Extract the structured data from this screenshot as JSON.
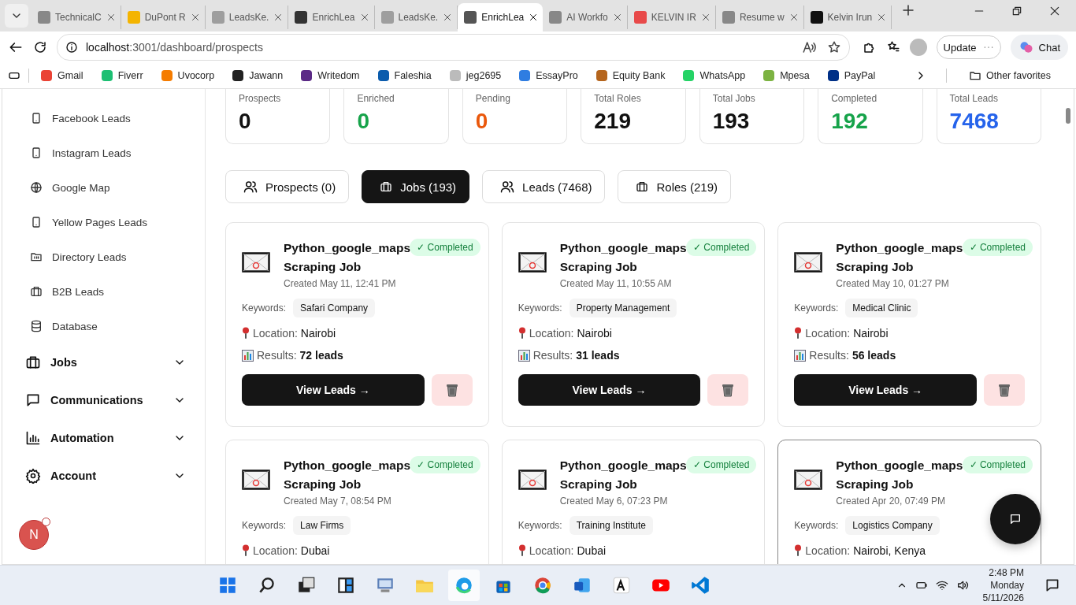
{
  "browser": {
    "tabs": [
      {
        "title": "TechnicalC",
        "selected": false
      },
      {
        "title": "DuPont R",
        "selected": false
      },
      {
        "title": "LeadsKe.",
        "selected": false
      },
      {
        "title": "EnrichLea",
        "selected": false
      },
      {
        "title": "LeadsKe.",
        "selected": false
      },
      {
        "title": "EnrichLea",
        "selected": true
      },
      {
        "title": "AI Workfo",
        "selected": false
      },
      {
        "title": "KELVIN IR",
        "selected": false
      },
      {
        "title": "Resume w",
        "selected": false
      },
      {
        "title": "Kelvin Irun",
        "selected": false
      }
    ],
    "address": {
      "host": "localhost",
      "path": ":3001/dashboard/prospects"
    },
    "update_button": "Update",
    "chat_button": "Chat",
    "bookmarks": [
      "Gmail",
      "Fiverr",
      "Uvocorp",
      "Jawann",
      "Writedom",
      "Faleshia",
      "jeg2695",
      "EssayPro",
      "Equity Bank",
      "WhatsApp",
      "Mpesa",
      "PayPal"
    ],
    "other_favorites": "Other favorites"
  },
  "sidebar": {
    "items": [
      {
        "kind": "link",
        "label": "Facebook Leads"
      },
      {
        "kind": "link",
        "label": "Instagram Leads"
      },
      {
        "kind": "link",
        "label": "Google Map"
      },
      {
        "kind": "link",
        "label": "Yellow Pages Leads"
      },
      {
        "kind": "link",
        "label": "Directory Leads"
      },
      {
        "kind": "link",
        "label": "B2B Leads"
      },
      {
        "kind": "link",
        "label": "Database"
      },
      {
        "kind": "group",
        "label": "Jobs",
        "expanded": false
      },
      {
        "kind": "group",
        "label": "Communications",
        "expanded": false
      },
      {
        "kind": "group",
        "label": "Automation",
        "expanded": false
      },
      {
        "kind": "group",
        "label": "Account",
        "expanded": false
      }
    ],
    "avatar": "N"
  },
  "stats": [
    {
      "label": "Prospects",
      "value": "0",
      "color": "#111111"
    },
    {
      "label": "Enriched",
      "value": "0",
      "color": "#16a34a"
    },
    {
      "label": "Pending",
      "value": "0",
      "color": "#ea580c"
    },
    {
      "label": "Total Roles",
      "value": "219",
      "color": "#111111"
    },
    {
      "label": "Total Jobs",
      "value": "193",
      "color": "#111111"
    },
    {
      "label": "Completed",
      "value": "192",
      "color": "#16a34a"
    },
    {
      "label": "Total Leads",
      "value": "7468",
      "color": "#2563eb"
    }
  ],
  "view_tabs": [
    {
      "label": "Prospects (0)",
      "selected": false
    },
    {
      "label": "Jobs (193)",
      "selected": true
    },
    {
      "label": "Leads (7468)",
      "selected": false
    },
    {
      "label": "Roles (219)",
      "selected": false
    }
  ],
  "jobs": [
    {
      "title": "Python_google_maps Scraping Job",
      "status_label": "✓ Completed",
      "created": "Created May 11, 12:41 PM",
      "keywords_label": "Keywords:",
      "keyword": "Safari Company",
      "location_label": "Location:",
      "location": "Nairobi",
      "results_label": "Results:",
      "results": "72 leads",
      "view_button": "View Leads →",
      "hovered": false
    },
    {
      "title": "Python_google_maps Scraping Job",
      "status_label": "✓ Completed",
      "created": "Created May 11, 10:55 AM",
      "keywords_label": "Keywords:",
      "keyword": "Property Management",
      "location_label": "Location:",
      "location": "Nairobi",
      "results_label": "Results:",
      "results": "31 leads",
      "view_button": "View Leads →",
      "hovered": false
    },
    {
      "title": "Python_google_maps Scraping Job",
      "status_label": "✓ Completed",
      "created": "Created May 10, 01:27 PM",
      "keywords_label": "Keywords:",
      "keyword": "Medical Clinic",
      "location_label": "Location:",
      "location": "Nairobi",
      "results_label": "Results:",
      "results": "56 leads",
      "view_button": "View Leads →",
      "hovered": false
    },
    {
      "title": "Python_google_maps Scraping Job",
      "status_label": "✓ Completed",
      "created": "Created May 7, 08:54 PM",
      "keywords_label": "Keywords:",
      "keyword": "Law Firms",
      "location_label": "Location:",
      "location": "Dubai",
      "hovered": false
    },
    {
      "title": "Python_google_maps Scraping Job",
      "status_label": "✓ Completed",
      "created": "Created May 6, 07:23 PM",
      "keywords_label": "Keywords:",
      "keyword": "Training Institute",
      "location_label": "Location:",
      "location": "Dubai",
      "hovered": false
    },
    {
      "title": "Python_google_maps Scraping Job",
      "status_label": "✓ Completed",
      "created": "Created Apr 20, 07:49 PM",
      "keywords_label": "Keywords:",
      "keyword": "Logistics Company",
      "location_label": "Location:",
      "location": "Nairobi, Kenya",
      "hovered": true
    }
  ],
  "taskbar": {
    "time": "2:48 PM",
    "day": "Monday",
    "date": "5/11/2026"
  }
}
